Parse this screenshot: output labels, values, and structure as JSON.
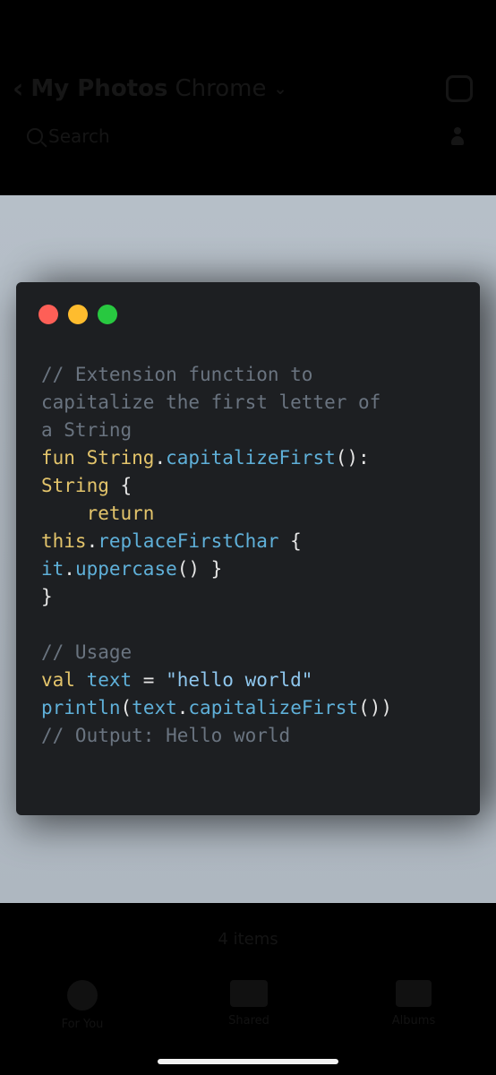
{
  "header": {
    "back_glyph": "‹",
    "album": "My Photos",
    "app": "Chrome",
    "search_label": "Search"
  },
  "code_window": {
    "dots": [
      "red",
      "yellow",
      "green"
    ],
    "lines": [
      [
        {
          "t": "// Extension function to",
          "c": "comment"
        }
      ],
      [
        {
          "t": "capitalize the first letter of",
          "c": "comment"
        }
      ],
      [
        {
          "t": "a String",
          "c": "comment"
        }
      ],
      [
        {
          "t": "fun ",
          "c": "kw"
        },
        {
          "t": "String",
          "c": "type"
        },
        {
          "t": ".",
          "c": "punct"
        },
        {
          "t": "capitalizeFirst",
          "c": "fn"
        },
        {
          "t": "():",
          "c": "punct"
        }
      ],
      [
        {
          "t": "String ",
          "c": "type"
        },
        {
          "t": "{",
          "c": "punct"
        }
      ],
      [
        {
          "t": "    return",
          "c": "kw"
        }
      ],
      [
        {
          "t": "this",
          "c": "kw"
        },
        {
          "t": ".",
          "c": "punct"
        },
        {
          "t": "replaceFirstChar ",
          "c": "fn"
        },
        {
          "t": "{",
          "c": "punct"
        }
      ],
      [
        {
          "t": "it",
          "c": "fn"
        },
        {
          "t": ".",
          "c": "punct"
        },
        {
          "t": "uppercase",
          "c": "fn"
        },
        {
          "t": "() }",
          "c": "punct"
        }
      ],
      [
        {
          "t": "}",
          "c": "punct"
        }
      ],
      [
        {
          "t": "",
          "c": "punct"
        }
      ],
      [
        {
          "t": "// Usage",
          "c": "comment"
        }
      ],
      [
        {
          "t": "val ",
          "c": "kw"
        },
        {
          "t": "text ",
          "c": "fn"
        },
        {
          "t": "= ",
          "c": "punct"
        },
        {
          "t": "\"hello world\"",
          "c": "str"
        }
      ],
      [
        {
          "t": "println",
          "c": "fn"
        },
        {
          "t": "(",
          "c": "punct"
        },
        {
          "t": "text",
          "c": "fn"
        },
        {
          "t": ".",
          "c": "punct"
        },
        {
          "t": "capitalizeFirst",
          "c": "fn"
        },
        {
          "t": "())",
          "c": "punct"
        }
      ],
      [
        {
          "t": "// Output: Hello world",
          "c": "comment"
        }
      ]
    ]
  },
  "footer": {
    "items_count": "4 items",
    "tabs": [
      "For You",
      "Shared",
      "Albums"
    ]
  },
  "colors": {
    "background_image": "#b6bfc8",
    "editor_bg": "#1d1f22",
    "comment": "#6a7480",
    "keyword": "#e3c46b",
    "function": "#5fb0d9"
  }
}
